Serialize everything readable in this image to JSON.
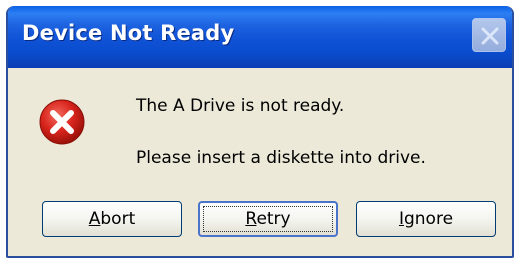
{
  "dialog": {
    "title": "Device Not Ready",
    "message_line1": "The A Drive is not ready.",
    "message_line2": "Please insert a diskette into drive."
  },
  "buttons": {
    "abort": {
      "mnemonic": "A",
      "rest": "bort"
    },
    "retry": {
      "mnemonic": "R",
      "rest": "etry"
    },
    "ignore": {
      "mnemonic": "I",
      "rest": "gnore"
    }
  },
  "icons": {
    "error": "error-icon",
    "close": "close-icon"
  },
  "colors": {
    "titlebar": "#0a4ccd",
    "dialog_bg": "#ece9d8",
    "error_red": "#d9251d"
  }
}
